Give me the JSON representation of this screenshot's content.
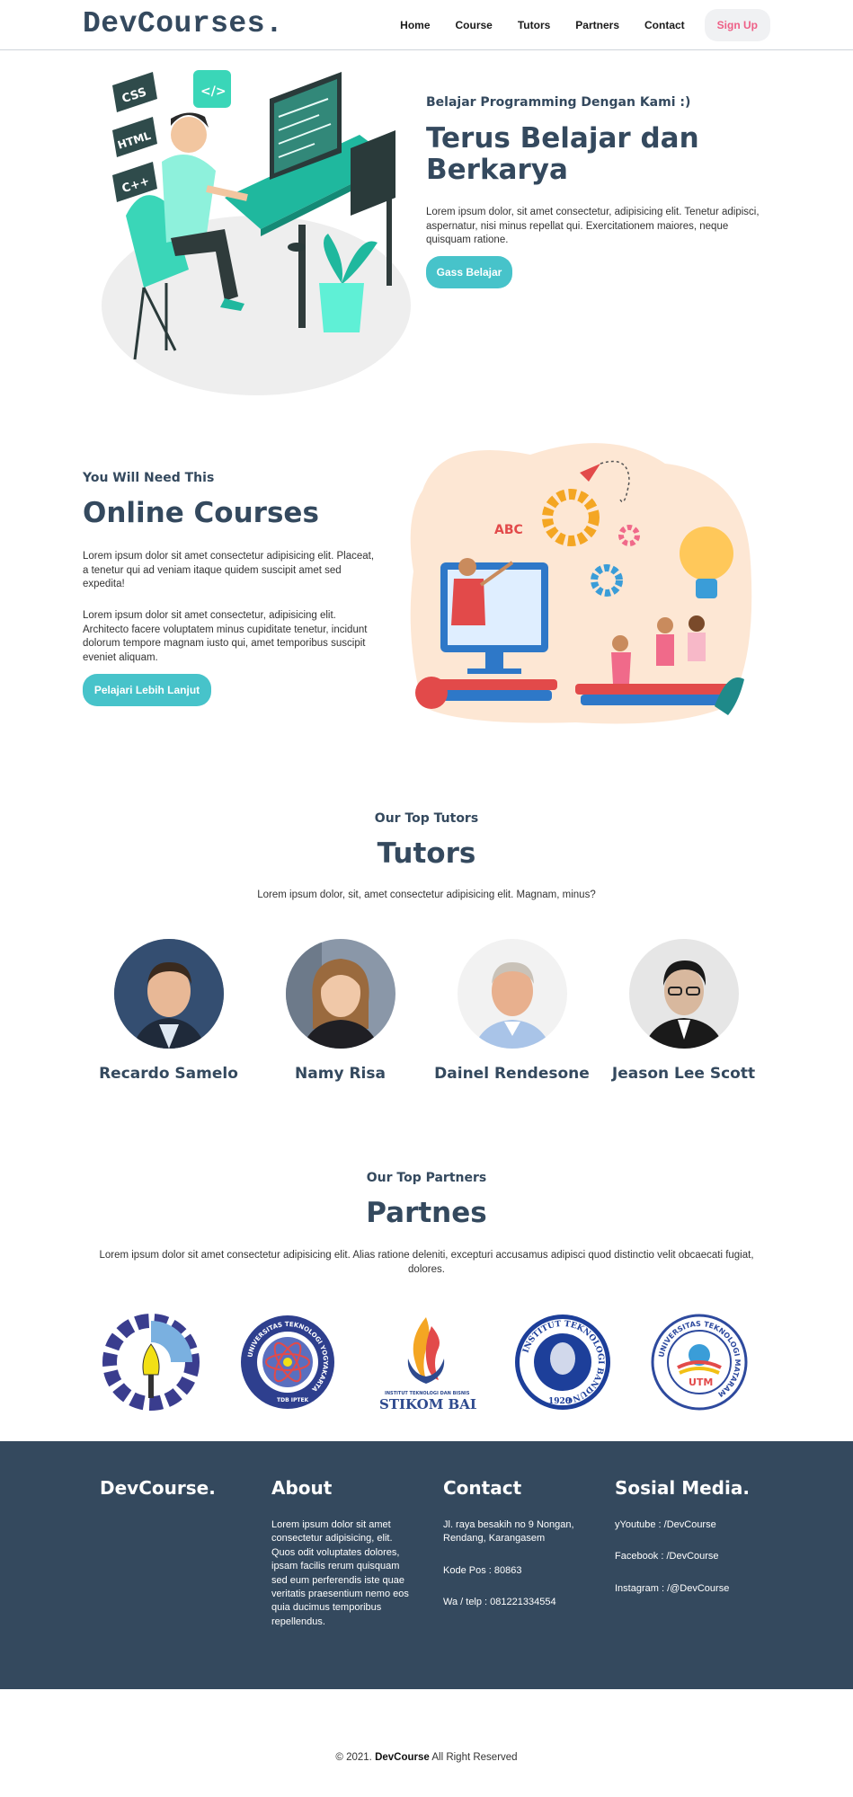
{
  "navbar": {
    "brand": "DevCourses.",
    "links": [
      "Home",
      "Course",
      "Tutors",
      "Partners",
      "Contact"
    ],
    "signup": "Sign Up"
  },
  "hero": {
    "subtitle": "Belajar Programming Dengan Kami :)",
    "title": "Terus Belajar dan Berkarya",
    "text": "Lorem ipsum dolor, sit amet consectetur, adipisicing elit. Tenetur adipisci, aspernatur, nisi minus repellat qui. Exercitationem maiores, neque quisquam ratione.",
    "button": "Gass Belajar",
    "badges": [
      "CSS",
      "HTML",
      "C++"
    ],
    "code_badge": "</>"
  },
  "online_courses": {
    "subtitle": "You Will Need This",
    "title": "Online Courses",
    "para1": "Lorem ipsum dolor sit amet consectetur adipisicing elit. Placeat, a tenetur qui ad veniam itaque quidem suscipit amet sed expedita!",
    "para2": "Lorem ipsum dolor sit amet consectetur, adipisicing elit. Architecto facere voluptatem minus cupiditate tenetur, incidunt dolorum tempore magnam iusto qui, amet temporibus suscipit eveniet aliquam.",
    "button": "Pelajari Lebih Lanjut",
    "board_text": "ABC"
  },
  "tutors": {
    "subtitle": "Our Top Tutors",
    "title": "Tutors",
    "text": "Lorem ipsum dolor, sit, amet consectetur adipisicing elit. Magnam, minus?",
    "list": [
      {
        "name": "Recardo Samelo"
      },
      {
        "name": "Namy Risa"
      },
      {
        "name": "Dainel Rendesone"
      },
      {
        "name": "Jeason Lee Scott"
      }
    ]
  },
  "partners": {
    "subtitle": "Our Top Partners",
    "title": "Partnes",
    "text": "Lorem ipsum dolor sit amet consectetur adipisicing elit. Alias ratione deleniti, excepturi accusamus adipisci quod distinctio velit obcaecati fugiat, dolores.",
    "logos": [
      {
        "id": "its"
      },
      {
        "id": "uty",
        "ring_text": "UNIVERSITAS TEKNOLOGI YOGYAKARTA",
        "bottom_text": "TDB IPTEK"
      },
      {
        "id": "stikom",
        "small_text": "INSTITUT TEKNOLOGI DAN BISNIS",
        "name": "STIKOM BALI"
      },
      {
        "id": "itb",
        "ring_text": "INSTITUT TEKNOLOGI BANDUNG",
        "year": "1920"
      },
      {
        "id": "utm",
        "ring_text": "UNIVERSITAS TEKNOLOGI MATARAM",
        "abbr": "UTM"
      }
    ]
  },
  "footer": {
    "brand": "DevCourse.",
    "about_title": "About",
    "about_text": "Lorem ipsum dolor sit amet consectetur adipisicing, elit. Quos odit voluptates dolores, ipsam facilis rerum quisquam sed eum perferendis iste quae veritatis praesentium nemo eos quia ducimus temporibus repellendus.",
    "contact_title": "Contact",
    "address": "Jl. raya besakih no 9 Nongan, Rendang, Karangasem",
    "postal": "Kode Pos : 80863",
    "phone": "Wa / telp : 081221334554",
    "social_title": "Sosial Media.",
    "youtube": "yYoutube : /DevCourse",
    "facebook": "Facebook : /DevCourse",
    "instagram": "Instagram : /@DevCourse"
  },
  "copyright": {
    "prefix": "© 2021.",
    "brand": "DevCourse",
    "suffix": "All Right Reserved"
  },
  "colors": {
    "primary": "#34495e",
    "accent": "#47c3ca",
    "signup": "#ee5f86"
  }
}
